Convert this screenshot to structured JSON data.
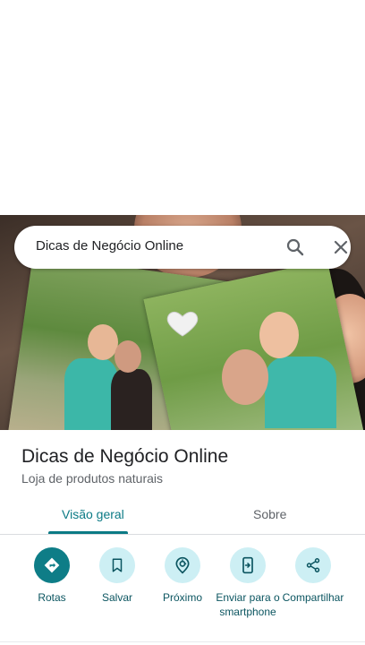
{
  "search": {
    "query": "Dicas de Negócio Online"
  },
  "place": {
    "title": "Dicas de Negócio Online",
    "category": "Loja de produtos naturais"
  },
  "tabs": [
    {
      "label": "Visão geral",
      "active": true
    },
    {
      "label": "Sobre",
      "active": false
    }
  ],
  "actions": [
    {
      "label": "Rotas",
      "icon": "directions-icon"
    },
    {
      "label": "Salvar",
      "icon": "bookmark-icon"
    },
    {
      "label": "Próximo",
      "icon": "nearby-icon"
    },
    {
      "label": "Enviar para o smartphone",
      "icon": "send-to-phone-icon"
    },
    {
      "label": "Compartilhar",
      "icon": "share-icon"
    }
  ],
  "colors": {
    "accent": "#0b7a85",
    "action_bg": "#cdeff4",
    "primary_action_bg": "#0e7d87"
  }
}
